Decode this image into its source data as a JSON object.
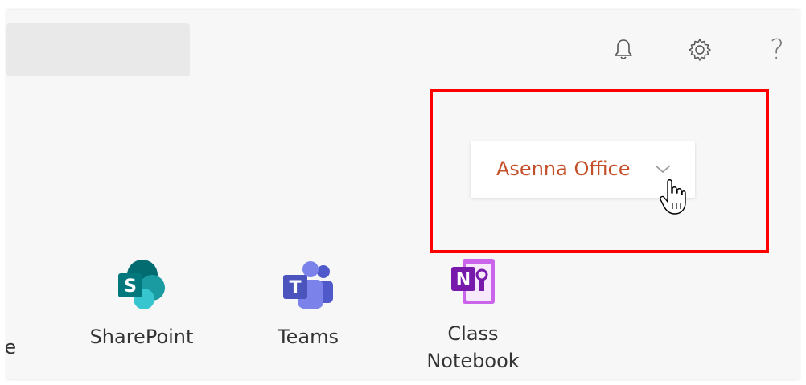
{
  "header": {
    "search": {
      "placeholder": ""
    },
    "icons": [
      "bell-icon",
      "gear-icon",
      "help-icon"
    ],
    "help_glyph": "?"
  },
  "tenant": {
    "label": "Asenna Office",
    "color": "#c4502a",
    "chevron_icon": "chevron-down-icon"
  },
  "highlight": {
    "color": "#ff0000"
  },
  "apps": [
    {
      "label": "te",
      "icon": "partial-app-icon"
    },
    {
      "label": "SharePoint",
      "icon": "sharepoint-icon"
    },
    {
      "label": "Teams",
      "icon": "teams-icon"
    },
    {
      "label_line1": "Class",
      "label_line2": "Notebook",
      "icon": "class-notebook-icon"
    }
  ]
}
